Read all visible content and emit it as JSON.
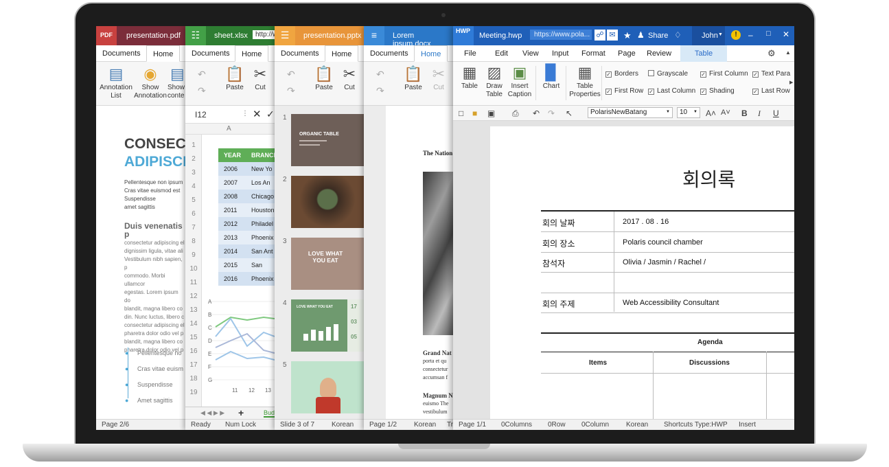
{
  "pdf": {
    "logo": "PDF",
    "filename": "presentation.pdf",
    "tabs": [
      "Documents",
      "Home"
    ],
    "ribbon": {
      "annotation_list": [
        "Annotation",
        "List"
      ],
      "show_annotation": [
        "Show",
        "Annotation"
      ],
      "show_content": [
        "Show",
        "conte"
      ]
    },
    "heading1": "CONSECT",
    "heading2": "ADIPISCI",
    "para1": [
      "Pellentesque non ipsum",
      "Cras vitae euismod est",
      "Suspendisse",
      "amet sagittis"
    ],
    "subheading": "Duis venenatis p",
    "para2": [
      "consectetur adipiscing el",
      "dignissim ligula, vitae ali",
      "Vestibulum nibh sapien, p",
      "commodo. Morbi ullamcor",
      "egestas. Lorem ipsum do",
      "blandit, magna libero co",
      "din. Nunc luctus, libero c",
      "consectetur adipiscing el",
      "pharetra dolor odio vel p",
      "blandit, magna libero co",
      "pharetra dolor odio vel p"
    ],
    "bullets": [
      "Pellentesque no",
      "Cras vitae euism",
      "Suspendisse",
      "Amet sagittis"
    ],
    "status_page": "Page 2/6"
  },
  "xlsx": {
    "filename": "sheet.xlsx",
    "url": "http://w",
    "tabs": [
      "Documents",
      "Home"
    ],
    "paste": "Paste",
    "cut": "Cut",
    "cell_ref": "I12",
    "col_a": "A",
    "row_numbers": [
      "1",
      "2",
      "3",
      "4",
      "5",
      "6",
      "7",
      "8",
      "9",
      "10",
      "11",
      "12",
      "13",
      "14",
      "15",
      "16",
      "17",
      "18",
      "19"
    ],
    "table_headers": [
      "YEAR",
      "BRANCH"
    ],
    "table_rows": [
      [
        "2006",
        "New Yo"
      ],
      [
        "2007",
        "Los An"
      ],
      [
        "2008",
        "Chicago"
      ],
      [
        "2011",
        "Houston"
      ],
      [
        "2012",
        "Philadel"
      ],
      [
        "2013",
        "Phoenix"
      ],
      [
        "2014",
        "San Ant"
      ],
      [
        "2015",
        "San Dieg"
      ],
      [
        "2016",
        "Phoenix"
      ]
    ],
    "chart_letters": [
      "A",
      "B",
      "C",
      "D",
      "E",
      "F",
      "G"
    ],
    "chart_x": [
      "11",
      "12",
      "13"
    ],
    "sheet_tab": "Bud",
    "status_ready": "Ready",
    "status_numlock": "Num Lock"
  },
  "pptx": {
    "filename": "presentation.pptx",
    "tabs": [
      "Documents",
      "Home"
    ],
    "paste": "Paste",
    "cut": "Cut",
    "slides": [
      {
        "num": "1",
        "title": "ORGANIC TABLE"
      },
      {
        "num": "2",
        "title": ""
      },
      {
        "num": "3",
        "title": "LOVE WHAT YOU EAT"
      },
      {
        "num": "4",
        "title": "LOVE WHAT YOU EAT",
        "values": [
          "17",
          "03",
          "05"
        ]
      },
      {
        "num": "5",
        "title": ""
      }
    ],
    "status_slide": "Slide 3 of 7",
    "status_lang": "Korean"
  },
  "docx": {
    "filename": "Lorem ipsum.docx",
    "tabs": [
      "Documents",
      "Home"
    ],
    "paste": "Paste",
    "cut": "Cut",
    "heading": "The Nation",
    "section1_title": "Grand Nat",
    "section1_lines": [
      "porta et qu",
      "consectetur",
      "accumsan f"
    ],
    "section2_title": "Magnum N",
    "section2_lines": [
      "euismo The",
      "vestibulum"
    ],
    "status_page": "Page 1/2",
    "status_lang": "Korean",
    "status_extra": "Tr"
  },
  "hwp": {
    "logo": "HWP",
    "filename": "Meeting.hwp",
    "url": "https://www.pola...",
    "share": "Share",
    "user": "John",
    "menu": [
      "File",
      "Edit",
      "View",
      "Input",
      "Format",
      "Page",
      "Review"
    ],
    "active_tab": "Table",
    "ribbon_buttons": [
      [
        "Table"
      ],
      [
        "Draw",
        "Table"
      ],
      [
        "Insert",
        "Caption"
      ],
      [
        "Chart"
      ],
      [
        "Table",
        "Properties"
      ]
    ],
    "checkboxes": [
      {
        "label": "Borders",
        "checked": true
      },
      {
        "label": "Grayscale",
        "checked": false
      },
      {
        "label": "First Column",
        "checked": true
      },
      {
        "label": "Text Para",
        "checked": true
      },
      {
        "label": "First Row",
        "checked": true
      },
      {
        "label": "Last Column",
        "checked": true
      },
      {
        "label": "Shading",
        "checked": true
      },
      {
        "label": "Last Row",
        "checked": true
      }
    ],
    "font_name": "PolarisNewBatang",
    "font_size": "10",
    "doc_title": "회의록",
    "rows": [
      {
        "label": "회의 날짜",
        "value": "2017 . 08 . 16"
      },
      {
        "label": "회의 장소",
        "value": "Polaris council chamber"
      },
      {
        "label": "참석자",
        "value": "Olivia / Jasmin / Rachel /"
      },
      {
        "label": "",
        "value": ""
      },
      {
        "label": "회의 주제",
        "value": "Web Accessibility Consultant"
      }
    ],
    "agenda": "Agenda",
    "agenda_cols": [
      "Items",
      "Discussions"
    ],
    "status": [
      "Page 1/1",
      "0Columns",
      "0Row",
      "0Column",
      "Korean",
      "Shortcuts Type:HWP",
      "Insert"
    ]
  },
  "colors": {
    "pdf": "#a83a3a",
    "xlsx": "#3f9c35",
    "pptx": "#f1a139",
    "docx": "#2f80d2",
    "hwp": "#2b6cc8",
    "accent_table": "#d8e9f7"
  }
}
